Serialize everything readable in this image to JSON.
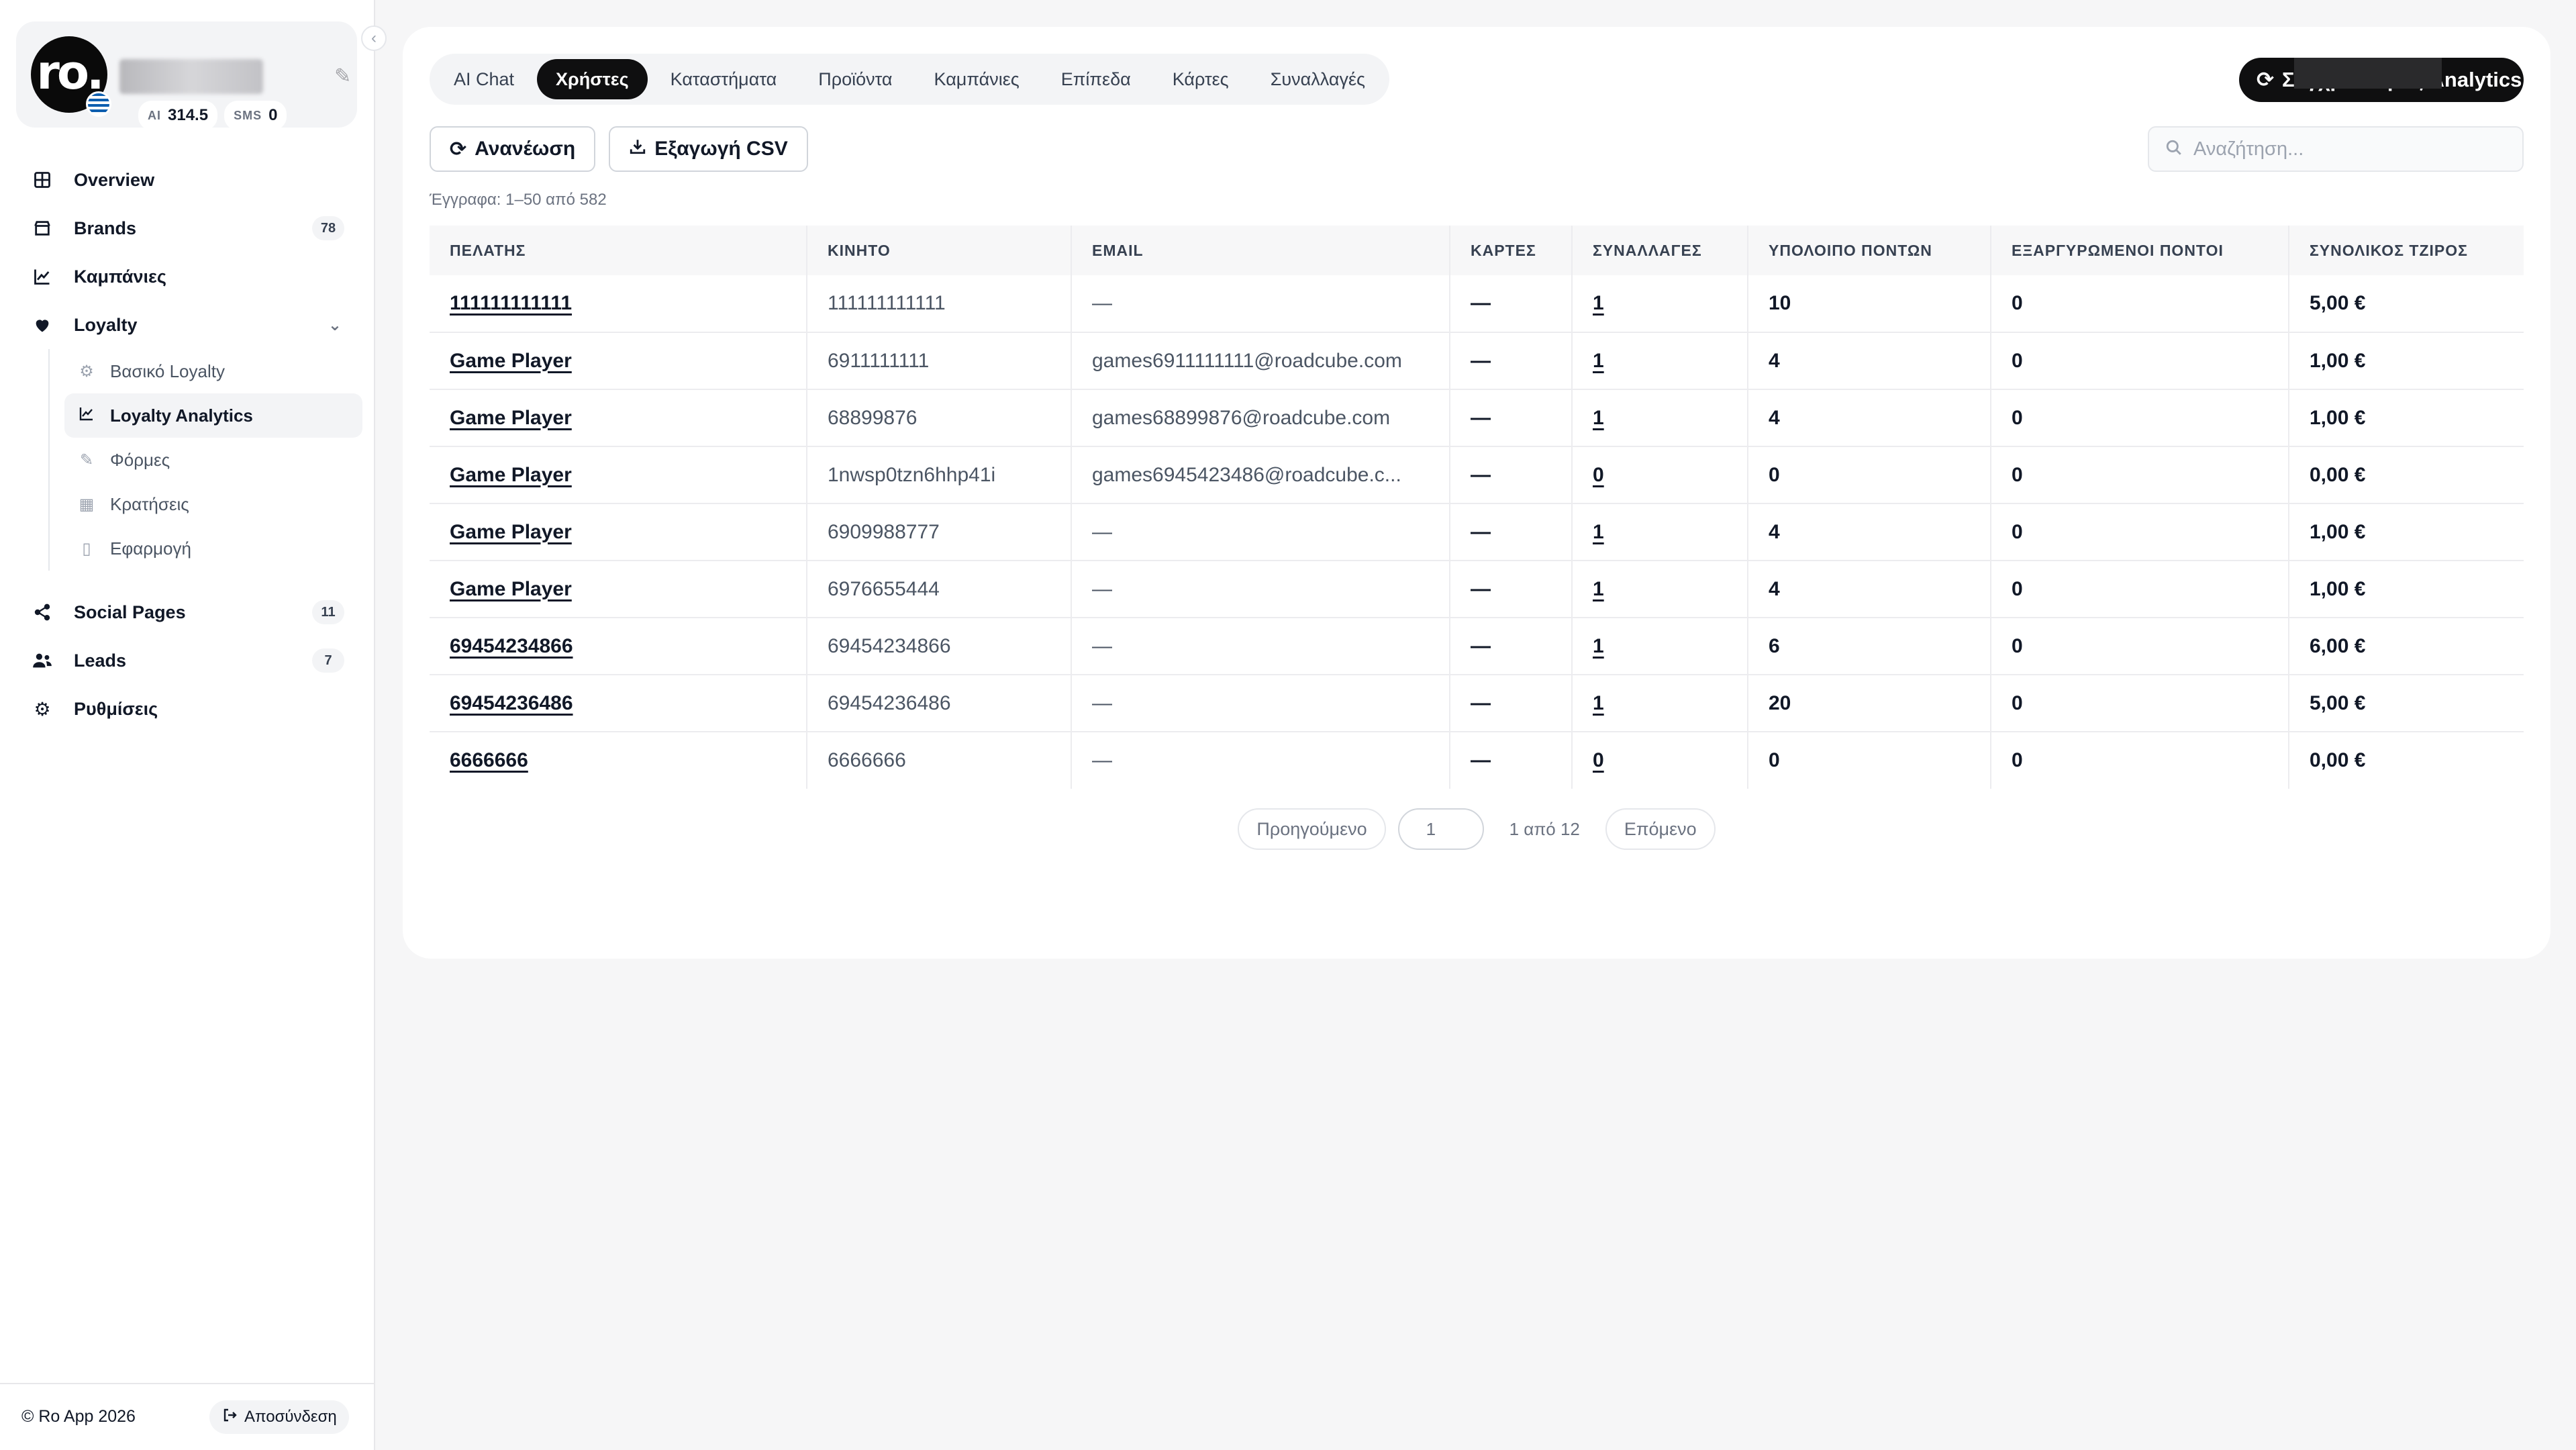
{
  "profile": {
    "avatar_text": "ro.",
    "ai_label": "AI",
    "ai_value": "314.5",
    "sms_label": "SMS",
    "sms_value": "0"
  },
  "nav": {
    "overview": "Overview",
    "brands": "Brands",
    "brands_count": "78",
    "campaigns": "Καμπάνιες",
    "loyalty": "Loyalty",
    "loyalty_sub": [
      "Βασικό Loyalty",
      "Loyalty Analytics",
      "Φόρμες",
      "Κρατήσεις",
      "Εφαρμογή"
    ],
    "social_pages": "Social Pages",
    "social_pages_count": "11",
    "leads": "Leads",
    "leads_count": "7",
    "settings": "Ρυθμίσεις"
  },
  "footer": {
    "copyright": "© Ro App  2026",
    "logout": "Αποσύνδεση"
  },
  "tabs": [
    "AI Chat",
    "Χρήστες",
    "Καταστήματα",
    "Προϊόντα",
    "Καμπάνιες",
    "Επίπεδα",
    "Κάρτες",
    "Συναλλαγές"
  ],
  "active_tab": "Χρήστες",
  "sync_button": "Συγχρονισμός Analytics",
  "toolbar": {
    "refresh": "Ανανέωση",
    "export_csv": "Εξαγωγή CSV"
  },
  "search": {
    "placeholder": "Αναζήτηση..."
  },
  "records_info": "Έγγραφα: 1–50 από 582",
  "table": {
    "headers": [
      "ΠΕΛΑΤΗΣ",
      "ΚΙΝΗΤΟ",
      "EMAIL",
      "ΚΑΡΤΕΣ",
      "ΣΥΝΑΛΛΑΓΕΣ",
      "ΥΠΟΛΟΙΠΟ ΠΟΝΤΩΝ",
      "ΕΞΑΡΓΥΡΩΜΕΝΟΙ ΠΟΝΤΟΙ",
      "ΣΥΝΟΛΙΚΟΣ ΤΖΙΡΟΣ"
    ],
    "rows": [
      [
        "111111111111",
        "111111111111",
        "—",
        "—",
        "1",
        "10",
        "0",
        "5,00 €"
      ],
      [
        "Game Player",
        "6911111111",
        "games6911111111@roadcube.com",
        "—",
        "1",
        "4",
        "0",
        "1,00 €"
      ],
      [
        "Game Player",
        "68899876",
        "games68899876@roadcube.com",
        "—",
        "1",
        "4",
        "0",
        "1,00 €"
      ],
      [
        "Game Player",
        "1nwsp0tzn6hhp41i",
        "games6945423486@roadcube.c...",
        "—",
        "0",
        "0",
        "0",
        "0,00 €"
      ],
      [
        "Game Player",
        "6909988777",
        "—",
        "—",
        "1",
        "4",
        "0",
        "1,00 €"
      ],
      [
        "Game Player",
        "6976655444",
        "—",
        "—",
        "1",
        "4",
        "0",
        "1,00 €"
      ],
      [
        "69454234866",
        "69454234866",
        "—",
        "—",
        "1",
        "6",
        "0",
        "6,00 €"
      ],
      [
        "69454236486",
        "69454236486",
        "—",
        "—",
        "1",
        "20",
        "0",
        "5,00 €"
      ],
      [
        "6666666",
        "6666666",
        "—",
        "—",
        "0",
        "0",
        "0",
        "0,00 €"
      ]
    ]
  },
  "pagination": {
    "prev": "Προηγούμενο",
    "current_page": "1",
    "info": "1 από 12",
    "next": "Επόμενο"
  }
}
